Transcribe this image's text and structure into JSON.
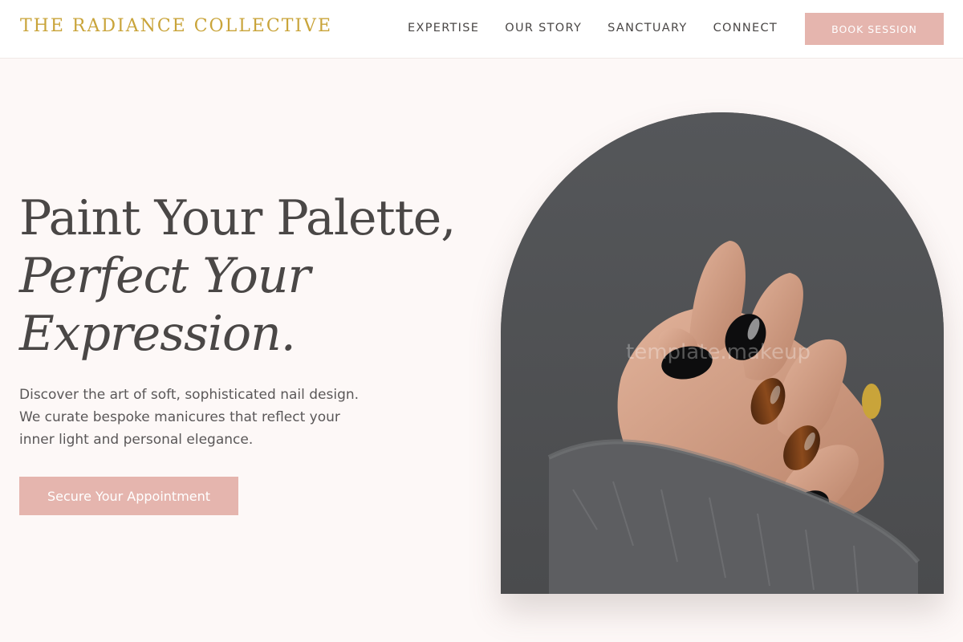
{
  "header": {
    "brand": "THE RADIANCE COLLECTIVE",
    "nav": [
      "EXPERTISE",
      "OUR STORY",
      "SANCTUARY",
      "CONNECT"
    ],
    "book_label": "BOOK SESSION"
  },
  "hero": {
    "title_line1": "Paint Your Palette,",
    "title_line2": "Perfect Your",
    "title_line3": "Expression.",
    "description": [
      "Discover the art of soft, sophisticated nail design.",
      "We curate bespoke manicures that reflect your",
      "inner light and personal elegance."
    ],
    "cta_label": "Secure Your Appointment"
  },
  "image": {
    "watermark": "template.makeup"
  },
  "colors": {
    "background": "#fdf8f7",
    "accent_gold": "#c9a43a",
    "button_pink": "#e5b5ae",
    "text_dark": "#4a4746"
  }
}
